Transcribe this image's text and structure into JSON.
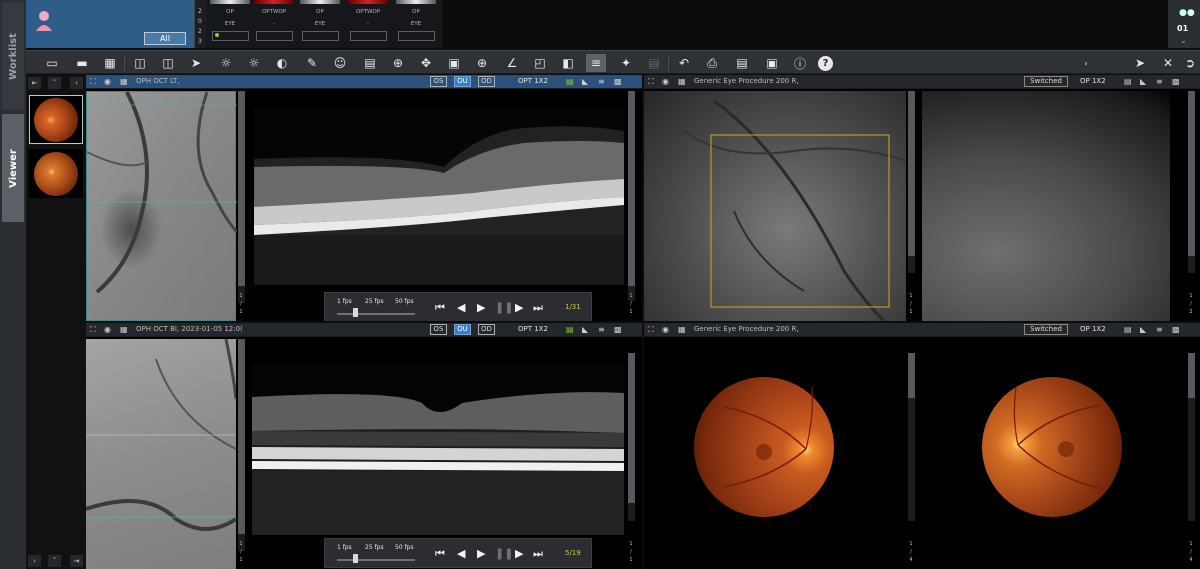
{
  "rail": {
    "worklist_label": "Worklist",
    "viewer_label": "Viewer"
  },
  "header": {
    "all_label": "All",
    "year_digits": [
      "2",
      "0",
      "2",
      "3"
    ],
    "series": [
      {
        "line1": "OP",
        "line2": "EYE",
        "value": "",
        "bar_color": "#e8e8e8",
        "selected": true
      },
      {
        "line1": "OPTWOP",
        "line2": "-",
        "value": "",
        "bar_color": "#d0232b"
      },
      {
        "line1": "OP",
        "line2": "EYE",
        "value": "",
        "bar_color": "#e8e8e8"
      },
      {
        "line1": "OPTWOP",
        "line2": "-",
        "value": "",
        "bar_color": "#d0232b"
      },
      {
        "line1": "OP",
        "line2": "EYE",
        "value": "",
        "bar_color": "#e8e8e8"
      }
    ],
    "tray_count": "01"
  },
  "viewports": {
    "top_left": {
      "label": "OPH OCT LT,",
      "eye_buttons": [
        "OS",
        "OU",
        "OD"
      ],
      "active_eye": "OU",
      "layout": "OPT 1X2",
      "player": {
        "fps_options": [
          "1 fps",
          "25 fps",
          "50 fps"
        ],
        "frame_counter": "1/31"
      },
      "index_marks": [
        "1",
        "/",
        "1"
      ]
    },
    "top_right": {
      "label": "Generic Eye Procedure 200 R,",
      "switched_label": "Switched",
      "layout": "OP 1X2",
      "index_marks": [
        "1",
        "/",
        "1"
      ],
      "index_marks_right": [
        "1",
        "/",
        "2"
      ]
    },
    "bottom_left": {
      "label": "OPH OCT BI, 2023-01-05 12:0(",
      "eye_buttons": [
        "OS",
        "OU",
        "OD"
      ],
      "active_eye": "OU",
      "layout": "OPT 1X2",
      "player": {
        "fps_options": [
          "1 fps",
          "25 fps",
          "50 fps"
        ],
        "frame_counter": "5/19"
      },
      "index_marks": [
        "1",
        "/",
        "1"
      ]
    },
    "bottom_right": {
      "label": "Generic Eye Procedure 200 R,",
      "switched_label": "Switched",
      "layout": "OP 1X2",
      "index_marks": [
        "1",
        "/",
        "4"
      ],
      "index_marks_right": [
        "1",
        "/",
        "4"
      ]
    }
  },
  "colors": {
    "active_header": "#2b5079",
    "eye_on": "#3b7ec2",
    "frame_counter": "#d3c23b",
    "roi_box": "#d4a52a"
  }
}
